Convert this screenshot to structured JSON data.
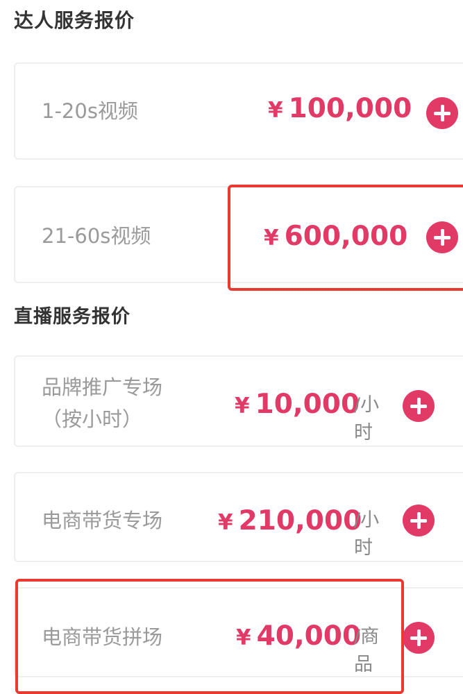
{
  "sections": {
    "talent": {
      "title": "达人服务报价",
      "items": [
        {
          "name": "1-20s视频",
          "currency": "¥",
          "price": "100,000"
        },
        {
          "name": "21-60s视频",
          "currency": "¥",
          "price": "600,000"
        }
      ]
    },
    "live": {
      "title": "直播服务报价",
      "items": [
        {
          "name_line1": "品牌推广专场",
          "name_line2": "（按小时）",
          "currency": "¥",
          "price": "10,000",
          "unit": "/小时"
        },
        {
          "name": "电商带货专场",
          "currency": "¥",
          "price": "210,000",
          "unit": "/小时"
        },
        {
          "name": "电商带货拼场",
          "currency": "¥",
          "price": "40,000",
          "unit": "/商品"
        }
      ]
    }
  },
  "colors": {
    "accent": "#e13a67",
    "highlight_box": "#e83a30",
    "name_text": "#9a9a9a",
    "title_text": "#333333"
  },
  "icons": {
    "add": "plus-circle-icon"
  }
}
